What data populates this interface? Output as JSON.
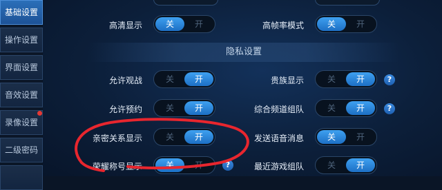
{
  "sidebar": {
    "items": [
      {
        "label": "基础设置",
        "active": true
      },
      {
        "label": "操作设置",
        "active": false
      },
      {
        "label": "界面设置",
        "active": false
      },
      {
        "label": "音效设置",
        "active": false
      },
      {
        "label": "录像设置",
        "active": false,
        "notification": true
      },
      {
        "label": "二级密码",
        "active": false
      }
    ]
  },
  "settings": {
    "hd_display": {
      "label": "高清显示",
      "off": "关",
      "on": "开",
      "value": "off"
    },
    "high_fps": {
      "label": "高帧率模式",
      "off": "关",
      "on": "开",
      "value": "off"
    },
    "privacy_section_title": "隐私设置",
    "allow_spectate": {
      "label": "允许观战",
      "off": "关",
      "on": "开",
      "value": "on"
    },
    "noble_display": {
      "label": "贵族显示",
      "off": "关",
      "on": "开",
      "value": "on"
    },
    "allow_reserve": {
      "label": "允许预约",
      "off": "关",
      "on": "开",
      "value": "on"
    },
    "channel_team": {
      "label": "综合频道组队",
      "off": "关",
      "on": "开",
      "value": "on"
    },
    "intimacy_display": {
      "label": "亲密关系显示",
      "off": "关",
      "on": "开",
      "value": "on"
    },
    "voice_message": {
      "label": "发送语音消息",
      "off": "关",
      "on": "开",
      "value": "off"
    },
    "honor_title": {
      "label": "荣耀称号显示",
      "off": "关",
      "on": "开",
      "value": "off"
    },
    "recent_team": {
      "label": "最近游戏组队",
      "off": "关",
      "on": "开",
      "value": "on"
    }
  },
  "help_icon": "?",
  "colors": {
    "accent": "#2a86e0",
    "annotation": "#e8262e",
    "notification": "#e53935"
  },
  "icons": [
    "help-icon",
    "notification-dot"
  ]
}
